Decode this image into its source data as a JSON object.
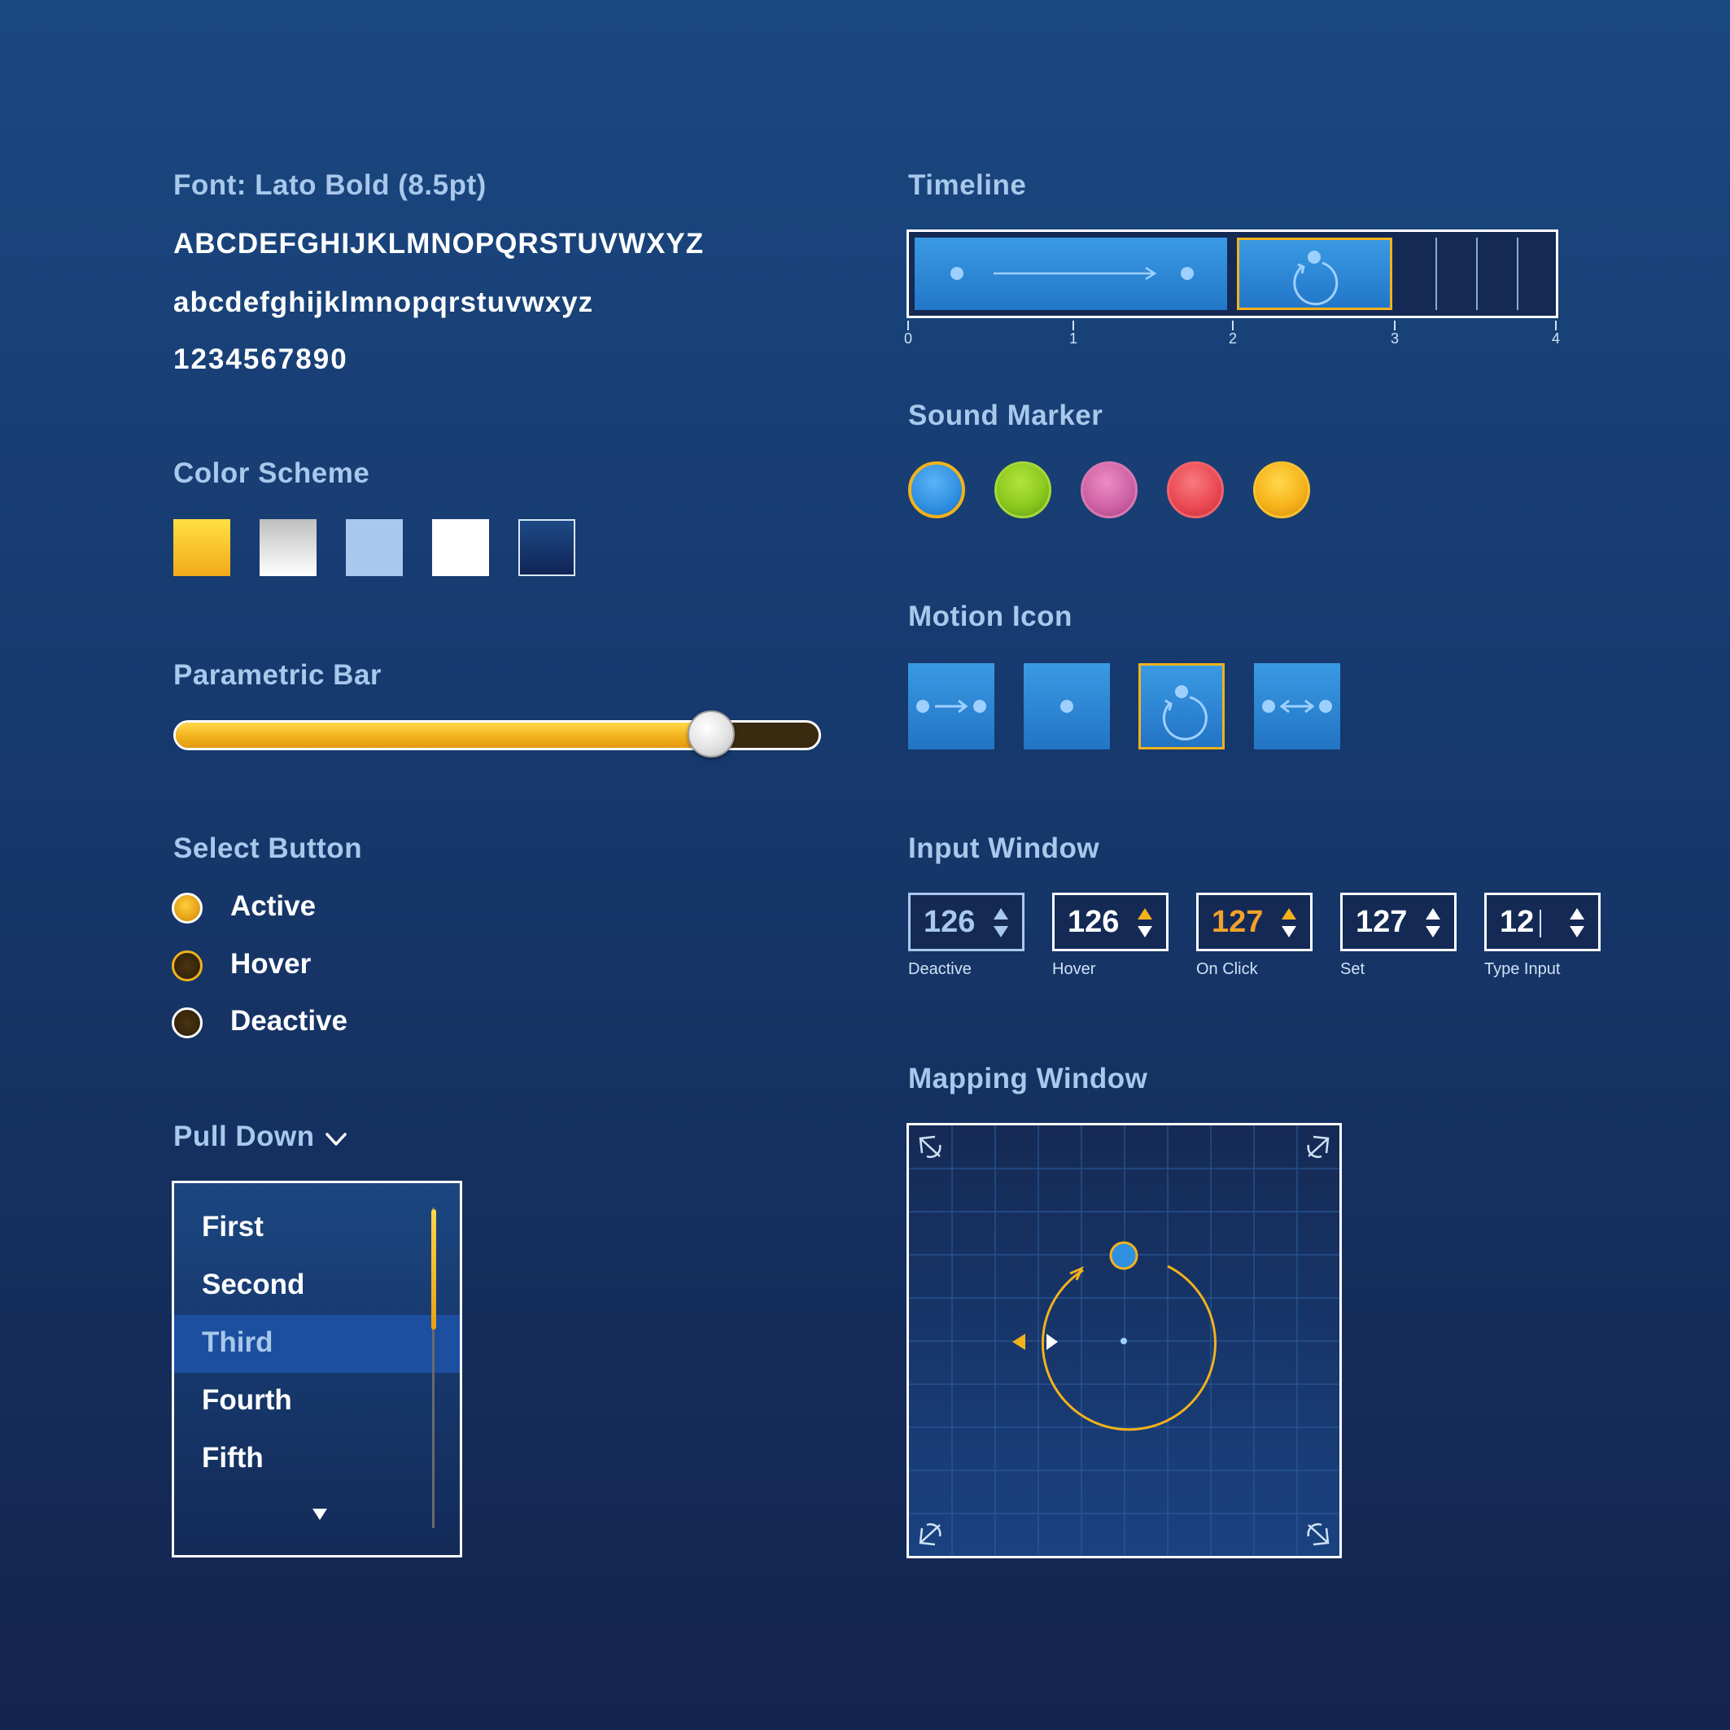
{
  "font_specimen": {
    "title": "Font: Lato Bold (8.5pt)",
    "uppercase": "ABCDEFGHIJKLMNOPQRSTUVWXYZ",
    "lowercase": "abcdefghijklmnopqrstuvwxyz",
    "digits": "1234567890"
  },
  "color_scheme": {
    "title": "Color Scheme",
    "swatches": [
      "#f8c22a",
      "#e6e6e6",
      "#a9c8ee",
      "#ffffff",
      "#16306a"
    ]
  },
  "parametric_bar": {
    "title": "Parametric Bar",
    "value": 0.83
  },
  "select_button": {
    "title": "Select Button",
    "options": [
      {
        "label": "Active"
      },
      {
        "label": "Hover"
      },
      {
        "label": "Deactive"
      }
    ]
  },
  "pull_down": {
    "title": "Pull Down",
    "items": [
      "First",
      "Second",
      "Third",
      "Fourth",
      "Fifth"
    ],
    "selected": "Third"
  },
  "timeline": {
    "title": "Timeline",
    "ticks": [
      "0",
      "1",
      "2",
      "3",
      "4"
    ]
  },
  "sound_marker": {
    "title": "Sound Marker",
    "colors": [
      "#2f8fe0",
      "#8cc91e",
      "#d064a6",
      "#ec4b55",
      "#f7b41c"
    ]
  },
  "motion_icon": {
    "title": "Motion Icon",
    "icons": [
      "move-arrow-icon",
      "point-icon",
      "rotate-icon",
      "bidirectional-arrow-icon"
    ]
  },
  "input_window": {
    "title": "Input Window",
    "boxes": [
      {
        "value": "126",
        "caption": "Deactive"
      },
      {
        "value": "126",
        "caption": "Hover"
      },
      {
        "value": "127",
        "caption": "On Click"
      },
      {
        "value": "127",
        "caption": "Set"
      },
      {
        "value": "12",
        "caption": "Type Input"
      }
    ]
  },
  "mapping_window": {
    "title": "Mapping Window"
  },
  "colors": {
    "accent": "#f2b21c",
    "title_text": "#a8c8ec",
    "background_top": "#1a4880",
    "background_bottom": "#14244e"
  }
}
